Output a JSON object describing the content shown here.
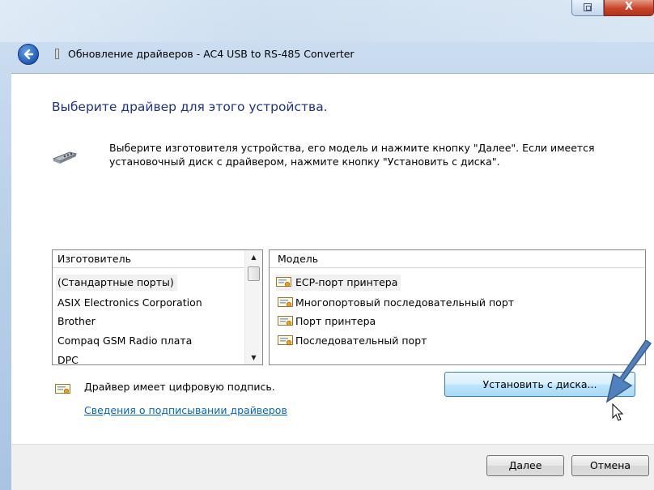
{
  "window": {
    "title": "Обновление драйверов - AC4 USB to RS-485 Converter",
    "close_glyph": "X"
  },
  "content": {
    "heading": "Выберите драйвер для этого устройства.",
    "description": "Выберите изготовителя устройства, его модель и нажмите кнопку \"Далее\". Если имеется установочный диск с  драйвером, нажмите кнопку \"Установить с диска\"."
  },
  "manufacturer_list": {
    "header": "Изготовитель",
    "items": [
      "(Стандартные порты)",
      "ASIX Electronics Corporation",
      "Brother",
      "Compaq GSM Radio плата",
      "DPC"
    ]
  },
  "model_list": {
    "header": "Модель",
    "items": [
      "ECP-порт принтера",
      "Многопортовый последовательный порт",
      "Порт принтера",
      "Последовательный порт"
    ]
  },
  "signature": {
    "text": "Драйвер имеет цифровую подпись.",
    "link": "Сведения о подписывании драйверов"
  },
  "buttons": {
    "install": "Установить с диска...",
    "next": "Далее",
    "cancel": "Отмена"
  },
  "colors": {
    "heading": "#1e3287",
    "link": "#0066cc",
    "arrow": "#4f81bd"
  },
  "icons": [
    "back-arrow-icon",
    "device-cable-icon",
    "certificate-icon",
    "mouse-pointer-icon"
  ]
}
